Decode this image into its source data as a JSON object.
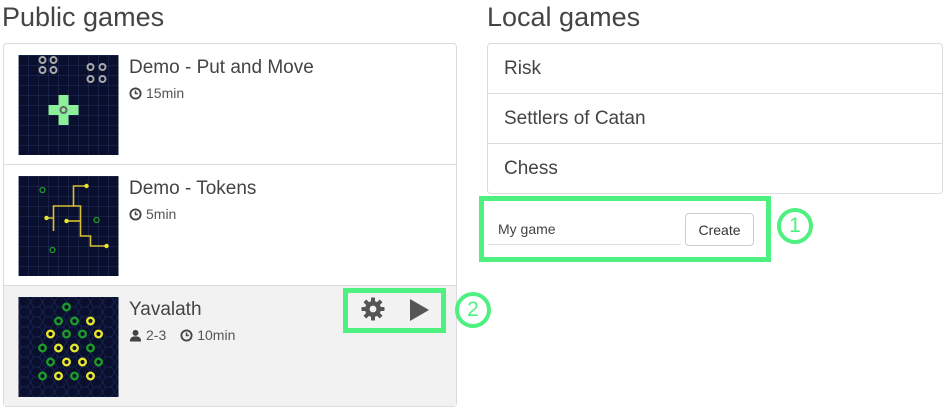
{
  "public_games": {
    "heading": "Public games",
    "games": [
      {
        "title": "Demo - Put and Move",
        "duration": "15min"
      },
      {
        "title": "Demo - Tokens",
        "duration": "5min"
      },
      {
        "title": "Yavalath",
        "players": "2-3",
        "duration": "10min"
      }
    ]
  },
  "local_games": {
    "heading": "Local games",
    "items": [
      "Risk",
      "Settlers of Catan",
      "Chess"
    ]
  },
  "create": {
    "input_value": "My game",
    "button_label": "Create"
  },
  "callouts": {
    "one": "1",
    "two": "2"
  },
  "colors": {
    "accent": "#4ef17f",
    "board": "#0a0f2e",
    "grid": "#2a3a6a",
    "tile": "#8cef9a",
    "token_yellow": "#e8e82a",
    "token_green": "#1e9a2a"
  }
}
